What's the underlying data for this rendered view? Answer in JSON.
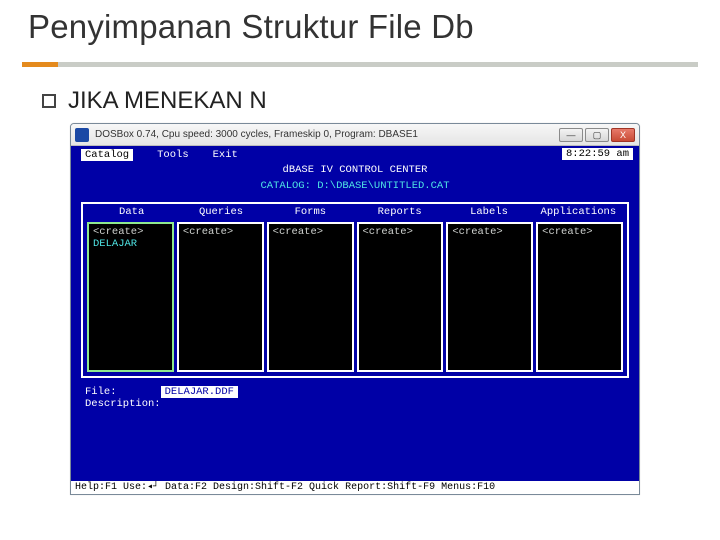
{
  "slide": {
    "title": "Penyimpanan Struktur File Db",
    "bullet": "JIKA MENEKAN N"
  },
  "dosbox": {
    "title": "DOSBox 0.74, Cpu speed:    3000 cycles, Frameskip  0, Program:   DBASE1",
    "buttons": {
      "min": "—",
      "max": "▢",
      "close": "X"
    }
  },
  "dos": {
    "menu": {
      "catalog": "Catalog",
      "tools": "Tools",
      "exit": "Exit"
    },
    "clock": "8:22:59 am",
    "title": "dBASE IV CONTROL CENTER",
    "catalog": "CATALOG: D:\\DBASE\\UNTITLED.CAT",
    "columns": [
      "Data",
      "Queries",
      "Forms",
      "Reports",
      "Labels",
      "Applications"
    ],
    "panels": [
      {
        "create": "<create>",
        "item": "DELAJAR",
        "selected": true
      },
      {
        "create": "<create>"
      },
      {
        "create": "<create>"
      },
      {
        "create": "<create>"
      },
      {
        "create": "<create>"
      },
      {
        "create": "<create>"
      }
    ],
    "file": {
      "label_file": "File:",
      "value_file": "DELAJAR.DDF",
      "label_desc": "Description:"
    },
    "help": "Help:F1  Use:◂┘  Data:F2  Design:Shift-F2  Quick Report:Shift-F9  Menus:F10"
  }
}
